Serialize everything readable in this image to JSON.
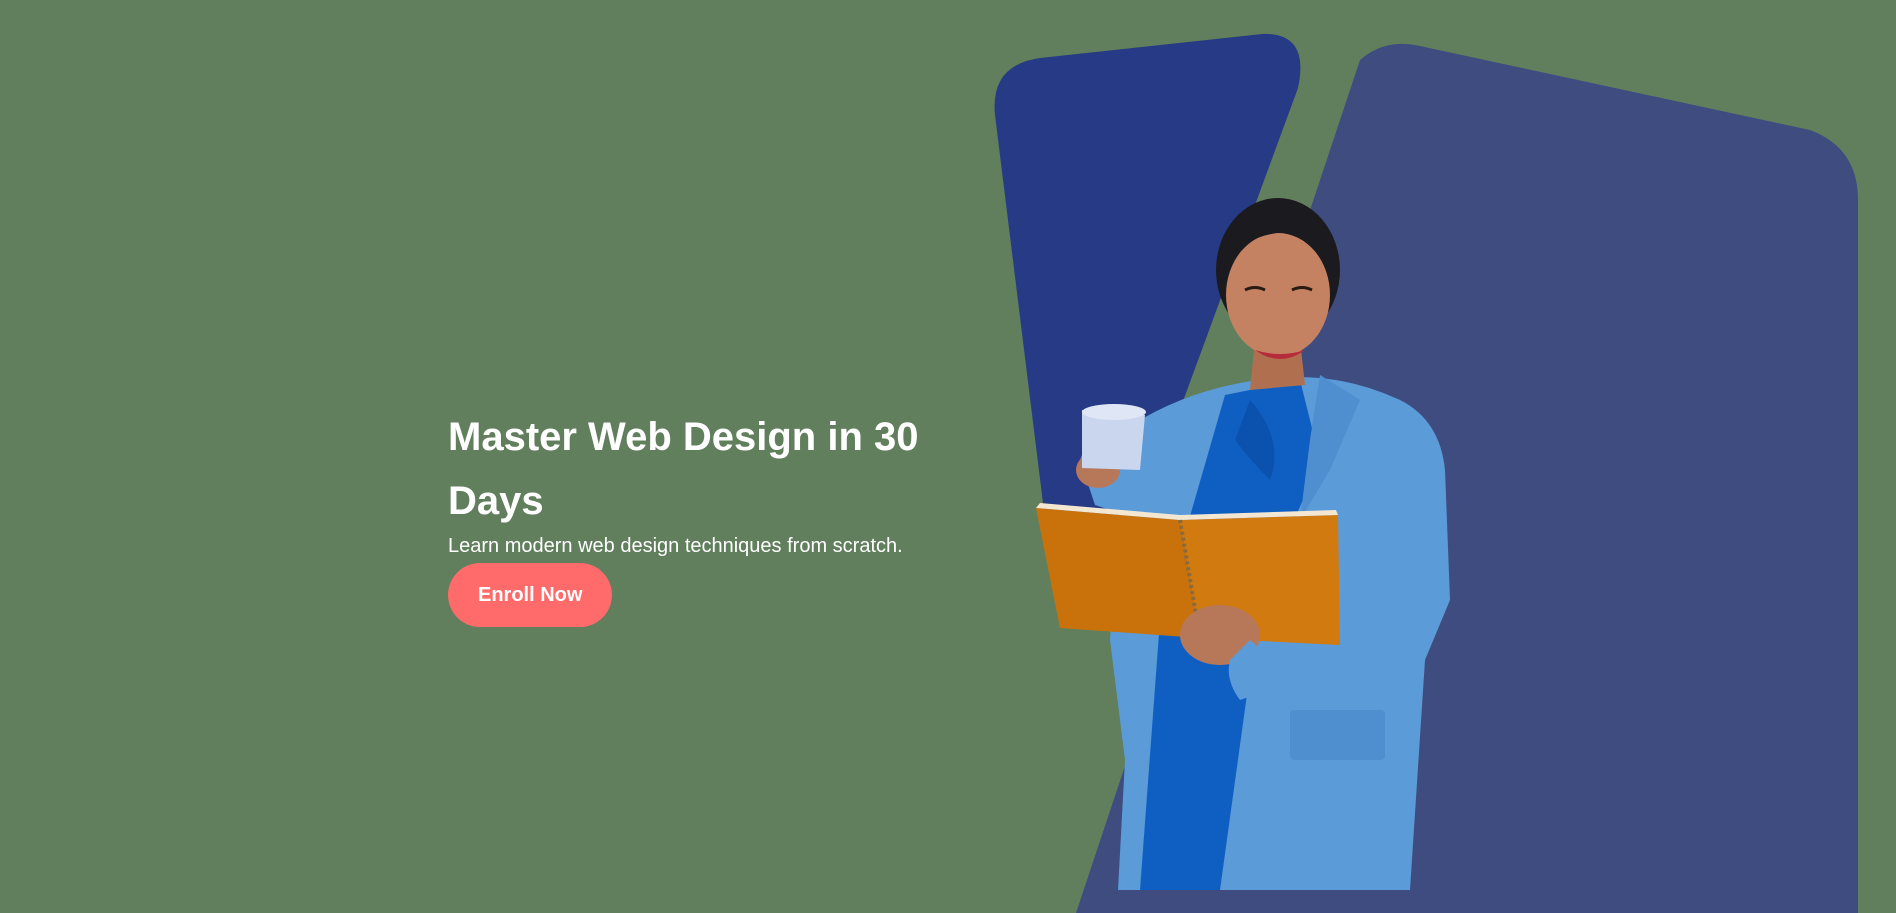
{
  "hero": {
    "title": "Master Web Design in 30 Days",
    "subtitle": "Learn modern web design techniques from scratch.",
    "cta_label": "Enroll Now"
  },
  "colors": {
    "background": "#617f5d",
    "shape_dark": "#273a85",
    "shape_light": "#3e4c80",
    "cta": "#ff6b6b",
    "text": "#ffffff"
  },
  "icons": {
    "illustration": "woman-reading-notebook-illustration"
  }
}
